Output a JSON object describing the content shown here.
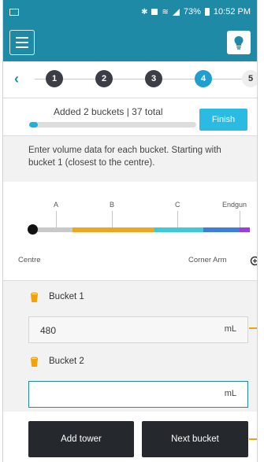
{
  "status_bar": {
    "battery": "73%",
    "time": "10:52 PM"
  },
  "steps": {
    "items": [
      "1",
      "2",
      "3",
      "4",
      "5"
    ],
    "active_index": 3
  },
  "progress": {
    "text": "Added 2 buckets | 37 total",
    "fraction": 0.054,
    "finish_label": "Finish"
  },
  "instruction": "Enter volume data for each bucket. Starting with bucket 1 (closest to the centre).",
  "diagram": {
    "zones": [
      "A",
      "B",
      "C",
      "Endgun"
    ],
    "centre_label": "Centre",
    "corner_label": "Corner Arm",
    "colors": {
      "gray": "#c9c9c9",
      "orange": "#f0a521",
      "teal": "#3fcbd6",
      "blue": "#3b7fd8",
      "purple": "#9b3fd6"
    }
  },
  "buckets": [
    {
      "label": "Bucket 1",
      "value": "480",
      "unit": "mL"
    },
    {
      "label": "Bucket 2",
      "value": "",
      "unit": "mL"
    }
  ],
  "buttons": {
    "add_tower": "Add tower",
    "next_bucket": "Next bucket"
  },
  "colors": {
    "brand": "#1f8aa5",
    "accent": "#2bbbe2",
    "bucket": "#f2a20a"
  }
}
